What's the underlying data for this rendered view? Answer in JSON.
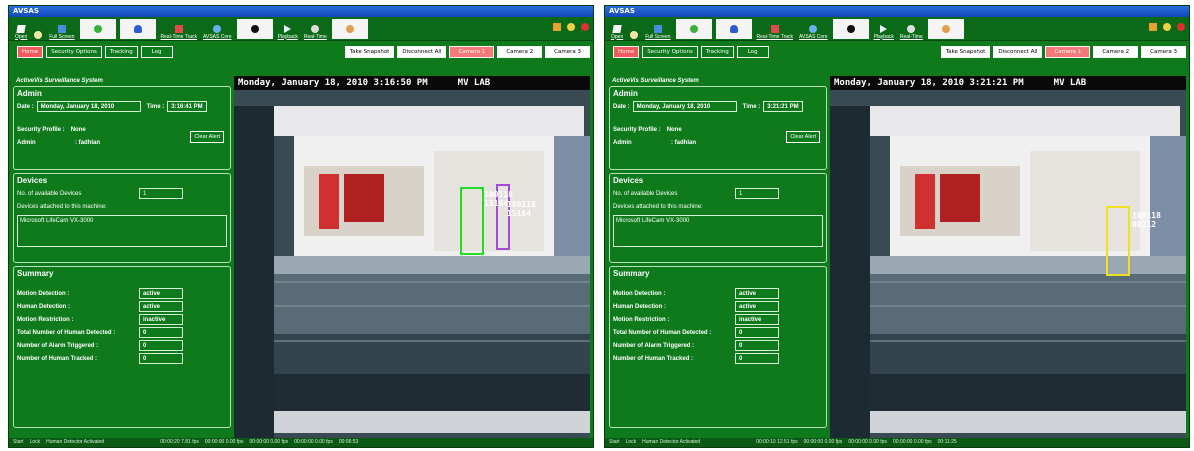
{
  "app_title": "AVSAS",
  "toolbar": {
    "open": "Open",
    "full_screen": "Full Screen",
    "realtime_track": "Real-Time Track",
    "avsas_core": "AVSAS Core",
    "playback": "Playback",
    "realtime": "Real-Time"
  },
  "nav": {
    "home": "Home",
    "security_options": "Security Options",
    "tracking": "Tracking",
    "log": "Log",
    "take_snapshot": "Take Snapshot",
    "disconnect_all": "Disconnect All",
    "camera1": "Camera 1",
    "camera2": "Camera 2",
    "camera3": "Camera 3"
  },
  "system_name": "ActiveVis Surveillance System",
  "admin": {
    "heading": "Admin",
    "date_label": "Date :",
    "time_label": "Time :",
    "security_profile_label": "Security Profile :",
    "security_profile_value": "None",
    "admin_label": "Admin",
    "admin_value": ": fadhlan",
    "clear_alert": "Clear Alert"
  },
  "devices": {
    "heading": "Devices",
    "count_label": "No. of available Devices",
    "count_value": "1",
    "attached_label": "Devices attached to this machine:",
    "device_name": "Microsoft LifeCam VX-3000"
  },
  "summary": {
    "heading": "Summary",
    "motion_detection_label": "Motion Detection :",
    "motion_detection_value": "active",
    "human_detection_label": "Human Detection :",
    "human_detection_value": "active",
    "motion_restriction_label": "Motion Restriction :",
    "motion_restriction_value": "inactive",
    "total_human_label": "Total Number of Human Detected :",
    "total_human_value": "0",
    "alarm_label": "Number of Alarm Triggered :",
    "alarm_value": "0",
    "tracked_label": "Number of Human Tracked :",
    "tracked_value": "0"
  },
  "status": {
    "start": "Start",
    "lock": "Lock",
    "activated": "Human Detector Activated"
  },
  "left": {
    "date_value": "Monday, January 18, 2010",
    "time_value": "3:16:41 PM",
    "video_stamp": "Monday, January 18, 2010 3:16:50 PM",
    "video_loc": "MV LAB",
    "fps1": "00:00:20 7.81 fps",
    "fps2": "00:00:00 0.00 fps",
    "fps3": "00:00:00 0.00 fps",
    "fps4": "00:00:00 0.00 fps",
    "clock": "00:06:53",
    "tag_a1": "100118",
    "tag_a2": "15164",
    "tag_b1": "100118",
    "tag_b2": "15164"
  },
  "right": {
    "date_value": "Monday, January 18, 2010",
    "time_value": "3:21:21 PM",
    "video_stamp": "Monday, January 18, 2010 3:21:21 PM",
    "video_loc": "MV LAB",
    "fps1": "00:00:10 12.51 fps",
    "fps2": "00:00:00 0.00 fps",
    "fps3": "00:00:00 0.00 fps",
    "fps4": "00:00:00 0.00 fps",
    "clock": "00:11:25",
    "tag_c1": "100118",
    "tag_c2": "00212"
  },
  "colors": {
    "window_green": "#0e7a1c",
    "home_red": "#f05a5a",
    "track_green": "#22dd22",
    "track_purple": "#a04cd8",
    "track_yellow": "#f0e020"
  }
}
